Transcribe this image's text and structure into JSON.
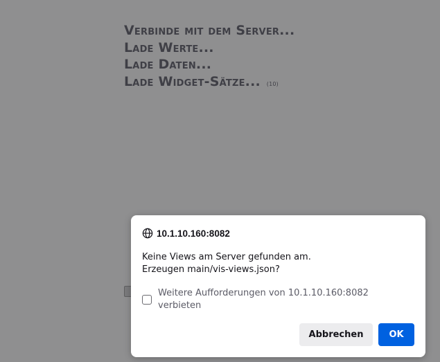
{
  "loading": {
    "lines": [
      "Verbinde mit dem Server...",
      "Lade Werte...",
      "Lade Daten...",
      "Lade Widget-Sätze..."
    ],
    "widget_count": "(10)"
  },
  "dialog": {
    "origin": "10.1.10.160:8082",
    "message_line1": "Keine Views am Server gefunden am.",
    "message_line2": "Erzeugen main/vis-views.json?",
    "suppress_label": "Weitere Aufforderungen von 10.1.10.160:8082 verbieten",
    "suppress_checked": false,
    "cancel_label": "Abbrechen",
    "ok_label": "OK"
  },
  "colors": {
    "overlay": "#8f8f90",
    "accent": "#0061e0"
  },
  "icons": {
    "origin_icon": "globe-icon"
  }
}
